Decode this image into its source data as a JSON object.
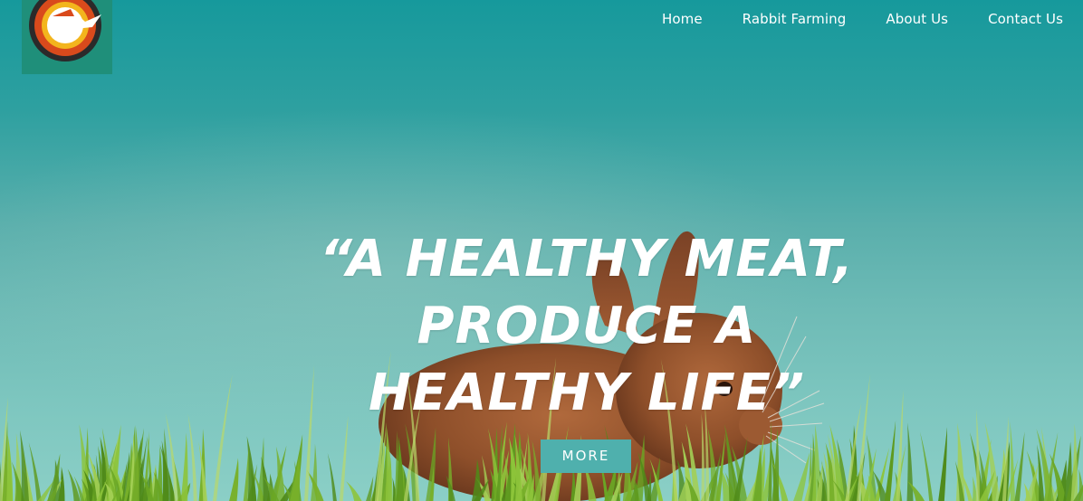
{
  "nav": {
    "items": [
      {
        "label": "Home"
      },
      {
        "label": "Rabbit Farming"
      },
      {
        "label": "About Us"
      },
      {
        "label": "Contact Us"
      }
    ]
  },
  "logo": {
    "icon": "rabbit-farm-logo"
  },
  "hero": {
    "headline_lines": [
      "“A HEALTHY MEAT,",
      "PRODUCE A",
      "HEALTHY LIFE”"
    ],
    "more_label": "MORE"
  },
  "colors": {
    "sky_top": "#16999c",
    "sky_bottom": "#8bcfc6",
    "button": "#4fb0ad",
    "text": "#ffffff"
  }
}
